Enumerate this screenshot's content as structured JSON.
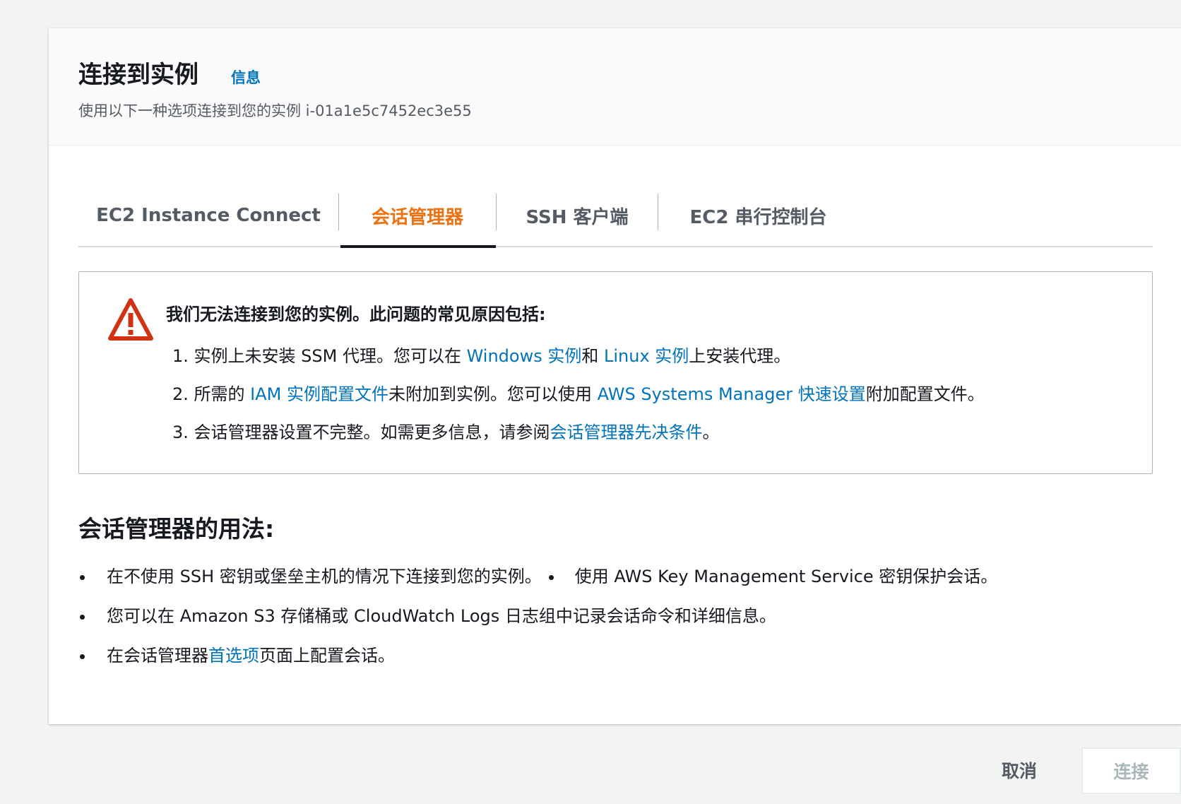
{
  "header": {
    "title": "连接到实例",
    "info_link": "信息",
    "subtitle": "使用以下一种选项连接到您的实例 i-01a1e5c7452ec3e55"
  },
  "tabs": [
    {
      "label": "EC2 Instance Connect",
      "active": false
    },
    {
      "label": "会话管理器",
      "active": true
    },
    {
      "label": "SSH 客户端",
      "active": false
    },
    {
      "label": "EC2 串行控制台",
      "active": false
    }
  ],
  "alert": {
    "title": "我们无法连接到您的实例。此问题的常见原因包括:",
    "items": [
      {
        "p1": "1. 实例上未安装 SSM 代理。您可以在 ",
        "link1": "Windows 实例",
        "p2": "和 ",
        "link2": "Linux 实例",
        "p3": "上安装代理。"
      },
      {
        "p1": "2. 所需的 ",
        "link1": "IAM 实例配置文件",
        "p2": "未附加到实例。您可以使用 ",
        "link2": "AWS Systems Manager 快速设置",
        "p3": "附加配置文件。"
      },
      {
        "p1": "3. 会话管理器设置不完整。如需更多信息，请参阅",
        "link1": "会话管理器先决条件",
        "p2": "。"
      }
    ]
  },
  "usage": {
    "title": "会话管理器的用法:",
    "items": [
      {
        "text_a": "在不使用 SSH 密钥或堡垒主机的情况下连接到您的实例。",
        "text_b": "使用 AWS Key Management Service 密钥保护会话。"
      },
      {
        "text": "您可以在 Amazon S3 存储桶或 CloudWatch Logs 日志组中记录会话命令和详细信息。"
      },
      {
        "p1": "在会话管理器",
        "link": "首选项",
        "p2": "页面上配置会话。"
      }
    ]
  },
  "footer": {
    "cancel_label": "取消",
    "connect_label": "连接"
  },
  "colors": {
    "accent": "#ec7211",
    "link": "#0073bb",
    "warning_icon": "#d13212"
  }
}
